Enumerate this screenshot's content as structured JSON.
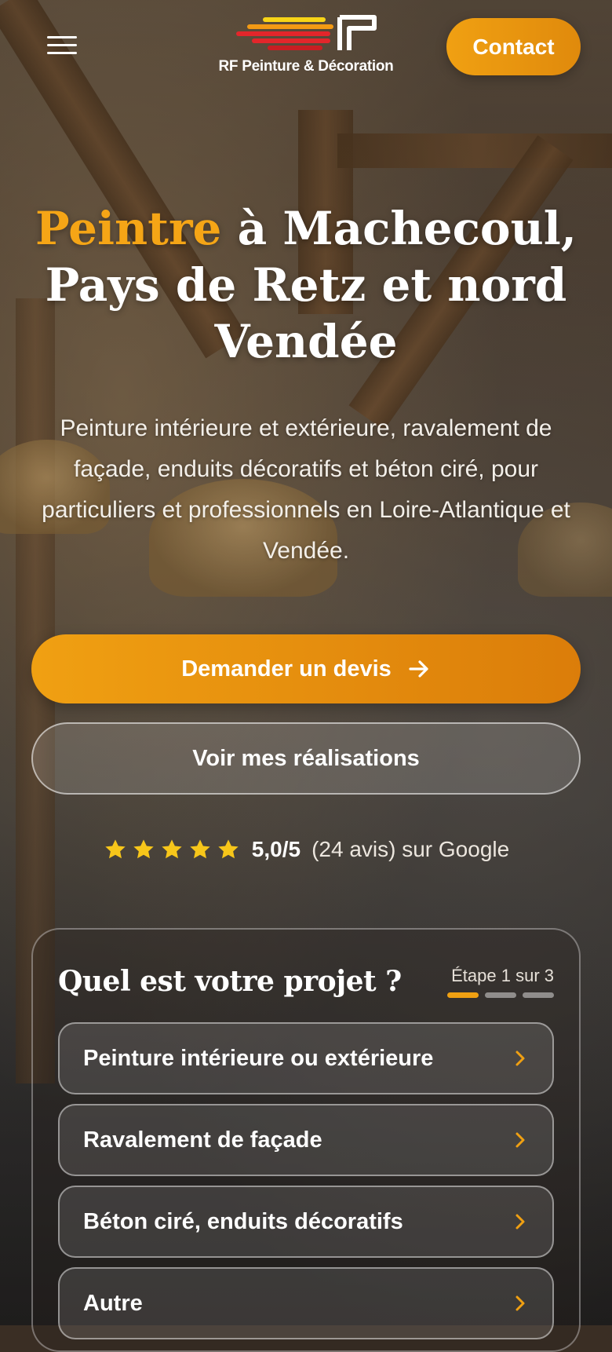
{
  "brand": {
    "name": "RF Peinture & Décoration",
    "colors": {
      "accent": "#f0a012",
      "accent_dark": "#db7d0a",
      "logo_red": "#e3262b",
      "logo_yellow": "#f7d417"
    }
  },
  "header": {
    "menu_icon": "hamburger-icon",
    "contact_label": "Contact"
  },
  "hero": {
    "title_accent": "Peintre",
    "title_rest": " à Machecoul, Pays de Retz et nord Vendée",
    "subtitle": "Peinture intérieure et extérieure, ravalement de façade, enduits décoratifs et béton ciré, pour particuliers et professionnels en Loire-Atlantique et Vendée.",
    "cta_primary": "Demander un devis",
    "cta_primary_icon": "arrow-right-icon",
    "cta_secondary": "Voir mes réalisations"
  },
  "rating": {
    "stars": 5,
    "score": "5,0/5",
    "details": "(24 avis) sur Google"
  },
  "project_card": {
    "title": "Quel est votre projet ?",
    "step_label": "Étape 1 sur 3",
    "step_current": 1,
    "step_total": 3,
    "options": [
      {
        "label": "Peinture intérieure ou extérieure"
      },
      {
        "label": "Ravalement de façade"
      },
      {
        "label": "Béton ciré, enduits décoratifs"
      },
      {
        "label": "Autre"
      }
    ]
  }
}
